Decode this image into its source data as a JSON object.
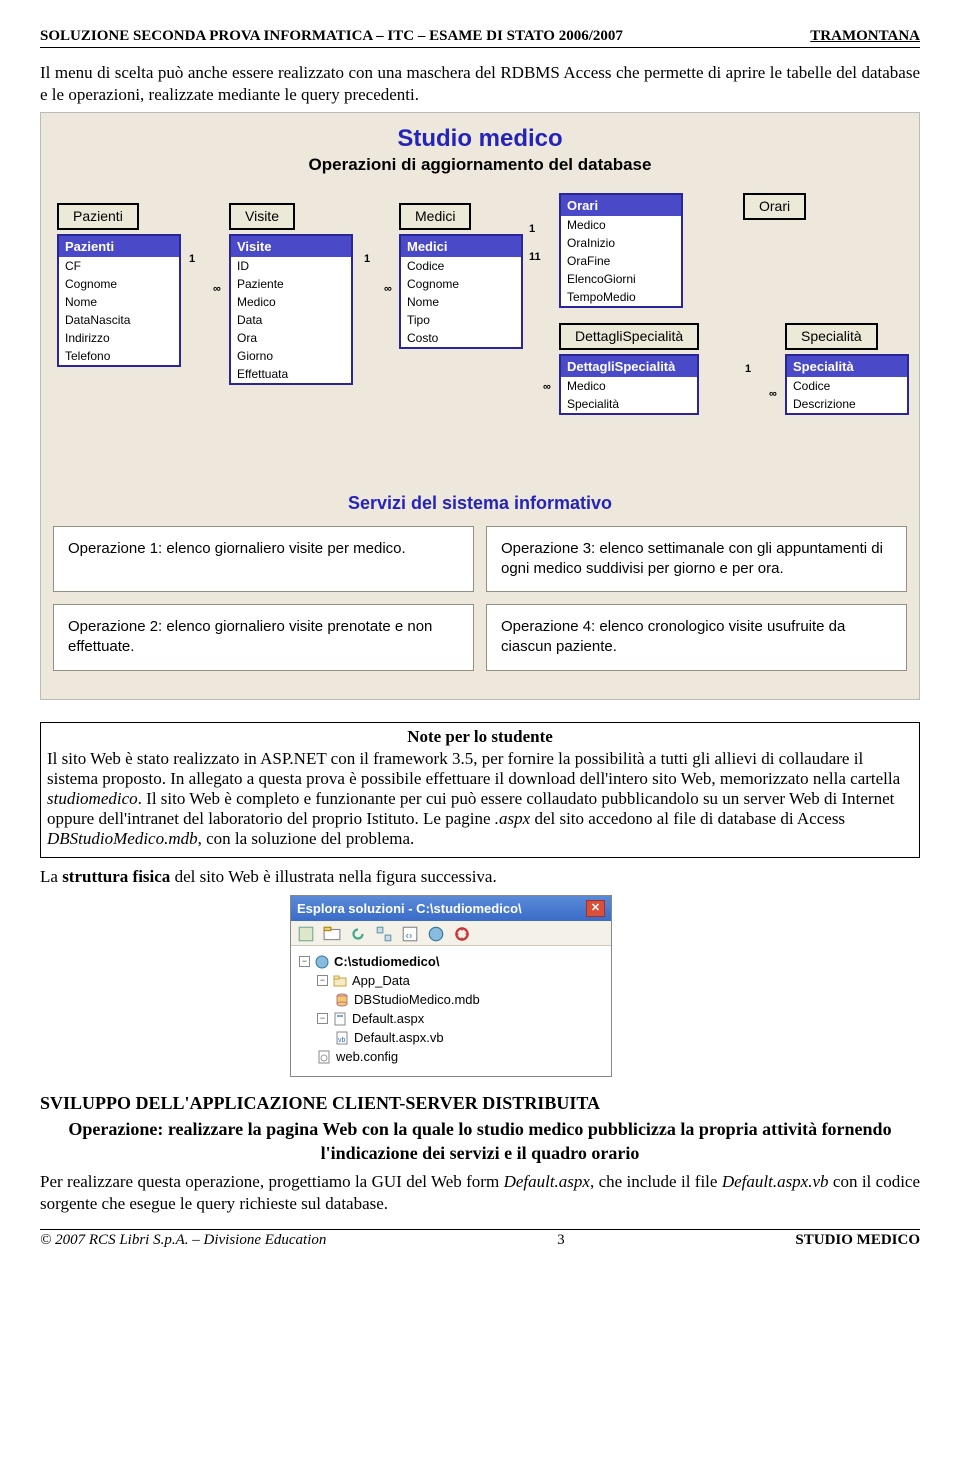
{
  "header": {
    "left": "SOLUZIONE SECONDA PROVA INFORMATICA – ITC – ESAME DI STATO 2006/2007",
    "right": "TRAMONTANA"
  },
  "intro": "Il menu di scelta può anche essere realizzato con una maschera del RDBMS Access che permette di aprire le tabelle del database e le operazioni, realizzate mediante le query precedenti.",
  "diagram": {
    "title": "Studio medico",
    "subtitle": "Operazioni di aggiornamento del database",
    "tables": {
      "pazienti": {
        "btn": "Pazienti",
        "name": "Pazienti",
        "fields": [
          "CF",
          "Cognome",
          "Nome",
          "DataNascita",
          "Indirizzo",
          "Telefono"
        ]
      },
      "visite": {
        "btn": "Visite",
        "name": "Visite",
        "fields": [
          "ID",
          "Paziente",
          "Medico",
          "Data",
          "Ora",
          "Giorno",
          "Effettuata"
        ]
      },
      "medici": {
        "btn": "Medici",
        "name": "Medici",
        "fields": [
          "Codice",
          "Cognome",
          "Nome",
          "Tipo",
          "Costo"
        ]
      },
      "orari": {
        "btn": "Orari",
        "name": "Orari",
        "fields": [
          "Medico",
          "OraInizio",
          "OraFine",
          "ElencoGiorni",
          "TempoMedio"
        ]
      },
      "dettagli": {
        "btn": "DettagliSpecialità",
        "name": "DettagliSpecialità",
        "fields": [
          "Medico",
          "Specialità"
        ]
      },
      "specialita": {
        "btn": "Specialità",
        "name": "Specialità",
        "fields": [
          "Codice",
          "Descrizione"
        ]
      }
    },
    "servizi": {
      "title": "Servizi del sistema informativo",
      "op1": "Operazione 1: elenco giornaliero visite per medico.",
      "op2": "Operazione 2: elenco giornaliero visite prenotate e non effettuate.",
      "op3": "Operazione 3: elenco settimanale con gli appuntamenti di ogni medico suddivisi per giorno e per ora.",
      "op4": "Operazione 4: elenco cronologico visite usufruite da ciascun paziente."
    }
  },
  "note": {
    "title": "Note per lo studente",
    "body_pre": "Il sito Web è stato realizzato in ASP.NET con il framework 3.5, per fornire la possibilità a tutti gli allievi di collaudare il sistema proposto. In allegato a questa prova è possibile effettuare il download dell'intero sito Web, memorizzato nella cartella ",
    "i1": "studiomedico",
    "body_mid": ". Il sito Web è completo e funzionante per cui può essere collaudato pubblicandolo su un server Web di Internet oppure dell'intranet del laboratorio del proprio Istituto. Le pagine ",
    "i2": ".aspx",
    "body_mid2": " del sito accedono al file di database di Access ",
    "i3": "DBStudioMedico.mdb",
    "body_end": ", con la soluzione del problema."
  },
  "struct_line_a": "La ",
  "struct_line_b": "struttura fisica",
  "struct_line_c": " del sito Web è illustrata nella figura successiva.",
  "explorer": {
    "title": "Esplora soluzioni - C:\\studiomedico\\",
    "root": "C:\\studiomedico\\",
    "n1": "App_Data",
    "n2": "DBStudioMedico.mdb",
    "n3": "Default.aspx",
    "n4": "Default.aspx.vb",
    "n5": "web.config"
  },
  "section2": "SVILUPPO DELL'APPLICAZIONE CLIENT-SERVER DISTRIBUITA",
  "op_title": "Operazione: realizzare la pagina Web con la quale lo studio medico pubblicizza la propria attività fornendo l'indicazione dei servizi e il quadro orario",
  "p2_a": "Per realizzare questa operazione, progettiamo la GUI del Web form ",
  "p2_i1": "Default.aspx",
  "p2_b": ", che include il file ",
  "p2_i2": "Default.aspx.vb",
  "p2_c": " con il codice sorgente che esegue le query richieste sul database.",
  "footer": {
    "left": "© 2007 RCS Libri S.p.A. – Divisione Education",
    "page": "3",
    "right": "STUDIO MEDICO"
  }
}
